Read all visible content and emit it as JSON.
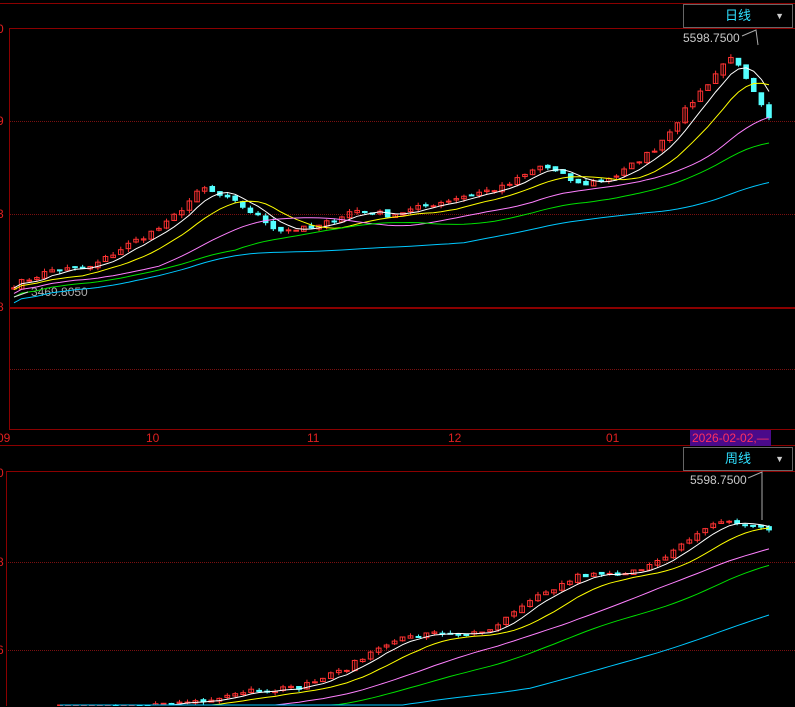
{
  "daily_panel": {
    "period_label": "日线",
    "dropdown_icon": "triangle-down",
    "y_labels": [
      "0",
      "9",
      "3",
      "8"
    ],
    "high_note": "5598.7500",
    "low_note": "3469.8050",
    "x_labels": [
      "09",
      "10",
      "11",
      "12",
      "01"
    ],
    "cursor_date": "2026-02-02,—",
    "close_anchors": [
      3560,
      3679,
      3695,
      3878,
      4038,
      4333,
      4197,
      3998,
      4014,
      4157,
      4118,
      4197,
      4277,
      4341,
      4516,
      4357,
      4436,
      4652,
      5034,
      5393,
      4875
    ]
  },
  "weekly_panel": {
    "period_label": "周线",
    "dropdown_icon": "triangle-down",
    "y_labels": [
      "0",
      "8",
      "6"
    ],
    "high_note": "5598.7500",
    "close_anchors": [
      3600,
      3700,
      3736,
      3776,
      3856,
      3872,
      4016,
      4256,
      4312,
      4304,
      4576,
      4776,
      4776,
      4976,
      5216,
      5136
    ]
  },
  "colors": {
    "up": "#ff3232",
    "down": "#54ffff",
    "ma5": "#ffffff",
    "ma10": "#ffff00",
    "ma20": "#ff80ff",
    "ma30": "#00e000",
    "ma60": "#00c8ff",
    "grid": "#8b0000"
  }
}
